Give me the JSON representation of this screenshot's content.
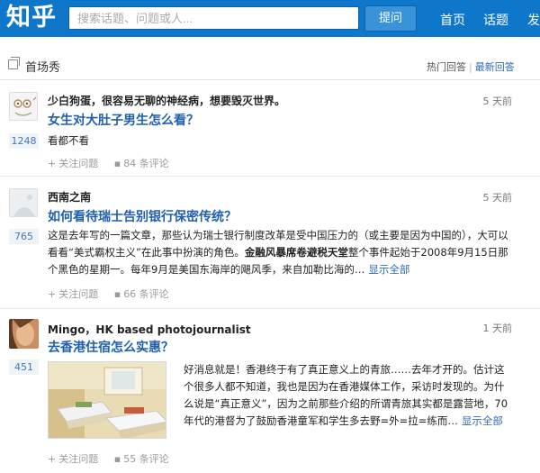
{
  "header": {
    "logo": "知乎",
    "search_placeholder": "搜索话题、问题或人...",
    "ask_button": "提问",
    "nav": [
      "首页",
      "话题",
      "发"
    ]
  },
  "section": {
    "title": "首场秀",
    "sort_hot": "热门回答",
    "sort_sep": "|",
    "sort_new": "最新回答"
  },
  "feed": [
    {
      "author": "少白狗蛋，很容易无聊的神经病，想要毁灭世界。",
      "time": "5 天前",
      "title": "女生对大肚子男生怎么看？",
      "votes": "1248",
      "body": "看都不看",
      "follow": "关注问题",
      "comments": "84 条评论"
    },
    {
      "author": "西南之南",
      "time": "5 天前",
      "title": "如何看待瑞士告别银行保密传统？",
      "votes": "765",
      "body_a": "这是去年写的一篇文章，那些认为瑞士银行制度改革是受中国压力的（或主要是因为中国的），大可以看看“美式霸权主义”在此事中扮演的角色。",
      "body_b": "金融风暴席卷避税天堂",
      "body_c": "整个事件起始于2008年9月15日那个黑色的星期一。每年9月是美国东海岸的飓风季，来自加勒比海的…",
      "show_all": "显示全部",
      "follow": "关注问题",
      "comments": "66 条评论"
    },
    {
      "author": "Mingo，HK based photojournalist",
      "time": "1 天前",
      "title": "去香港住宿怎么实惠？",
      "votes": "451",
      "body": "好消息就是！香港终于有了真正意义上的青旅……去年才开的。估计这个很多人都不知道，我也是因为在香港媒体工作，采访时发现的。为什么说是“真正意义”，因为之前那些介绍的所谓青旅其实都是露营地，70年代的港督为了鼓励香港童军和学生多去野=外=拉=练而…",
      "show_all": "显示全部",
      "follow": "关注问题",
      "comments": "55 条评论"
    }
  ],
  "colors": {
    "topbar": "#0e77ca",
    "link": "#1f5fad",
    "vote_bg": "#eef3fa"
  }
}
